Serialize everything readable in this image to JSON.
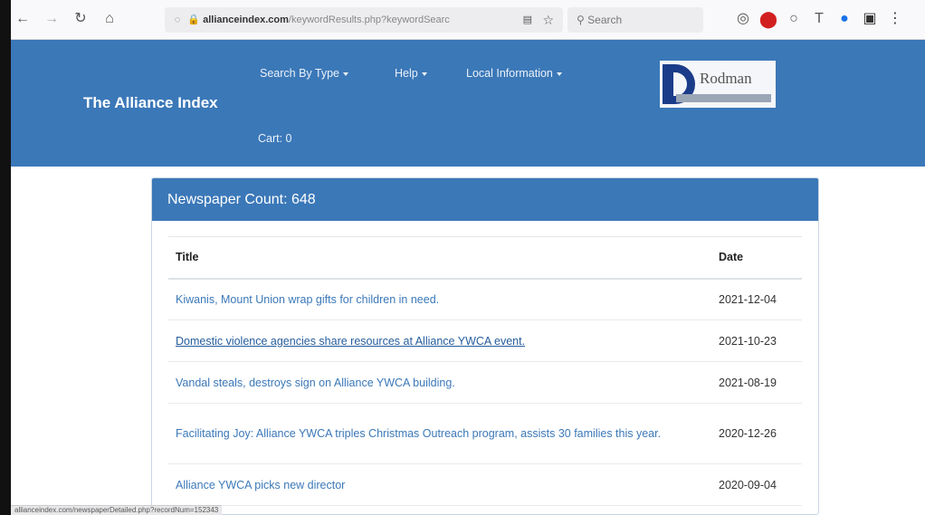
{
  "browser": {
    "url_host": "allianceindex.com",
    "url_path": "/keywordResults.php?keywordSearc",
    "search_placeholder": "Search",
    "status_url": "allianceindex.com/newspaperDetailed.php?recordNum=152343"
  },
  "header": {
    "brand": "The Alliance Index",
    "nav": [
      {
        "label": "Search By Type"
      },
      {
        "label": "Help"
      },
      {
        "label": "Local Information"
      }
    ],
    "cart": "Cart: 0",
    "logo_text": "Rodman"
  },
  "card": {
    "heading": "Newspaper Count: 648",
    "columns": {
      "title": "Title",
      "date": "Date"
    },
    "rows": [
      {
        "title": "Kiwanis, Mount Union wrap gifts for children in need.",
        "date": "2021-12-04"
      },
      {
        "title": "Domestic violence agencies share resources at Alliance YWCA event.",
        "date": "2021-10-23"
      },
      {
        "title": "Vandal steals, destroys sign on Alliance YWCA building.",
        "date": "2021-08-19"
      },
      {
        "title": "Facilitating Joy: Alliance YWCA triples Christmas Outreach program, assists 30 families this year.",
        "date": "2020-12-26"
      },
      {
        "title": "Alliance YWCA picks new director",
        "date": "2020-09-04"
      }
    ]
  },
  "colors": {
    "brand_blue": "#3b78b8",
    "link_blue": "#3b78b8"
  }
}
